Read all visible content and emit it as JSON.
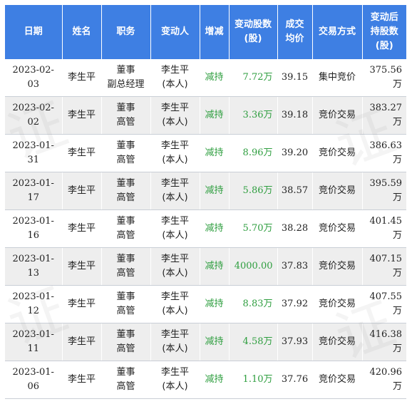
{
  "headers": {
    "date": "日期",
    "name": "姓名",
    "position": "职务",
    "changer": "变动人",
    "direction": "增减",
    "change_shares_l1": "变动股数",
    "change_shares_l2": "(股)",
    "avg_price_l1": "成交",
    "avg_price_l2": "均价",
    "method": "交易方式",
    "after_l1": "变动后",
    "after_l2": "持股数",
    "after_l3": "(股)"
  },
  "colors": {
    "header_bg": "#3e7fe3",
    "change_text": "#2e9e3f",
    "row_even_bg": "#eeeeee"
  },
  "rows": [
    {
      "date": "2023-02-03",
      "name": "李生平",
      "pos1": "董事",
      "pos2": "副总经理",
      "chg1": "李生平",
      "chg2": "(本人)",
      "dir": "减持",
      "shares": "7.72万",
      "price": "39.15",
      "method": "集中竞价",
      "after": "375.56万"
    },
    {
      "date": "2023-02-02",
      "name": "李生平",
      "pos1": "董事",
      "pos2": "高管",
      "chg1": "李生平",
      "chg2": "(本人)",
      "dir": "减持",
      "shares": "3.36万",
      "price": "39.18",
      "method": "竞价交易",
      "after": "383.27万"
    },
    {
      "date": "2023-01-31",
      "name": "李生平",
      "pos1": "董事",
      "pos2": "高管",
      "chg1": "李生平",
      "chg2": "(本人)",
      "dir": "减持",
      "shares": "8.96万",
      "price": "39.20",
      "method": "竞价交易",
      "after": "386.63万"
    },
    {
      "date": "2023-01-17",
      "name": "李生平",
      "pos1": "董事",
      "pos2": "高管",
      "chg1": "李生平",
      "chg2": "(本人)",
      "dir": "减持",
      "shares": "5.86万",
      "price": "38.57",
      "method": "竞价交易",
      "after": "395.59万"
    },
    {
      "date": "2023-01-16",
      "name": "李生平",
      "pos1": "董事",
      "pos2": "高管",
      "chg1": "李生平",
      "chg2": "(本人)",
      "dir": "减持",
      "shares": "5.70万",
      "price": "38.28",
      "method": "竞价交易",
      "after": "401.45万"
    },
    {
      "date": "2023-01-13",
      "name": "李生平",
      "pos1": "董事",
      "pos2": "高管",
      "chg1": "李生平",
      "chg2": "(本人)",
      "dir": "减持",
      "shares": "4000.00",
      "price": "37.83",
      "method": "竞价交易",
      "after": "407.15万"
    },
    {
      "date": "2023-01-12",
      "name": "李生平",
      "pos1": "董事",
      "pos2": "高管",
      "chg1": "李生平",
      "chg2": "(本人)",
      "dir": "减持",
      "shares": "8.83万",
      "price": "37.92",
      "method": "竞价交易",
      "after": "407.55万"
    },
    {
      "date": "2023-01-11",
      "name": "李生平",
      "pos1": "董事",
      "pos2": "高管",
      "chg1": "李生平",
      "chg2": "(本人)",
      "dir": "减持",
      "shares": "4.58万",
      "price": "37.93",
      "method": "竞价交易",
      "after": "416.38万"
    },
    {
      "date": "2023-01-06",
      "name": "李生平",
      "pos1": "董事",
      "pos2": "高管",
      "chg1": "李生平",
      "chg2": "(本人)",
      "dir": "减持",
      "shares": "1.10万",
      "price": "37.76",
      "method": "竞价交易",
      "after": "420.96万"
    }
  ]
}
